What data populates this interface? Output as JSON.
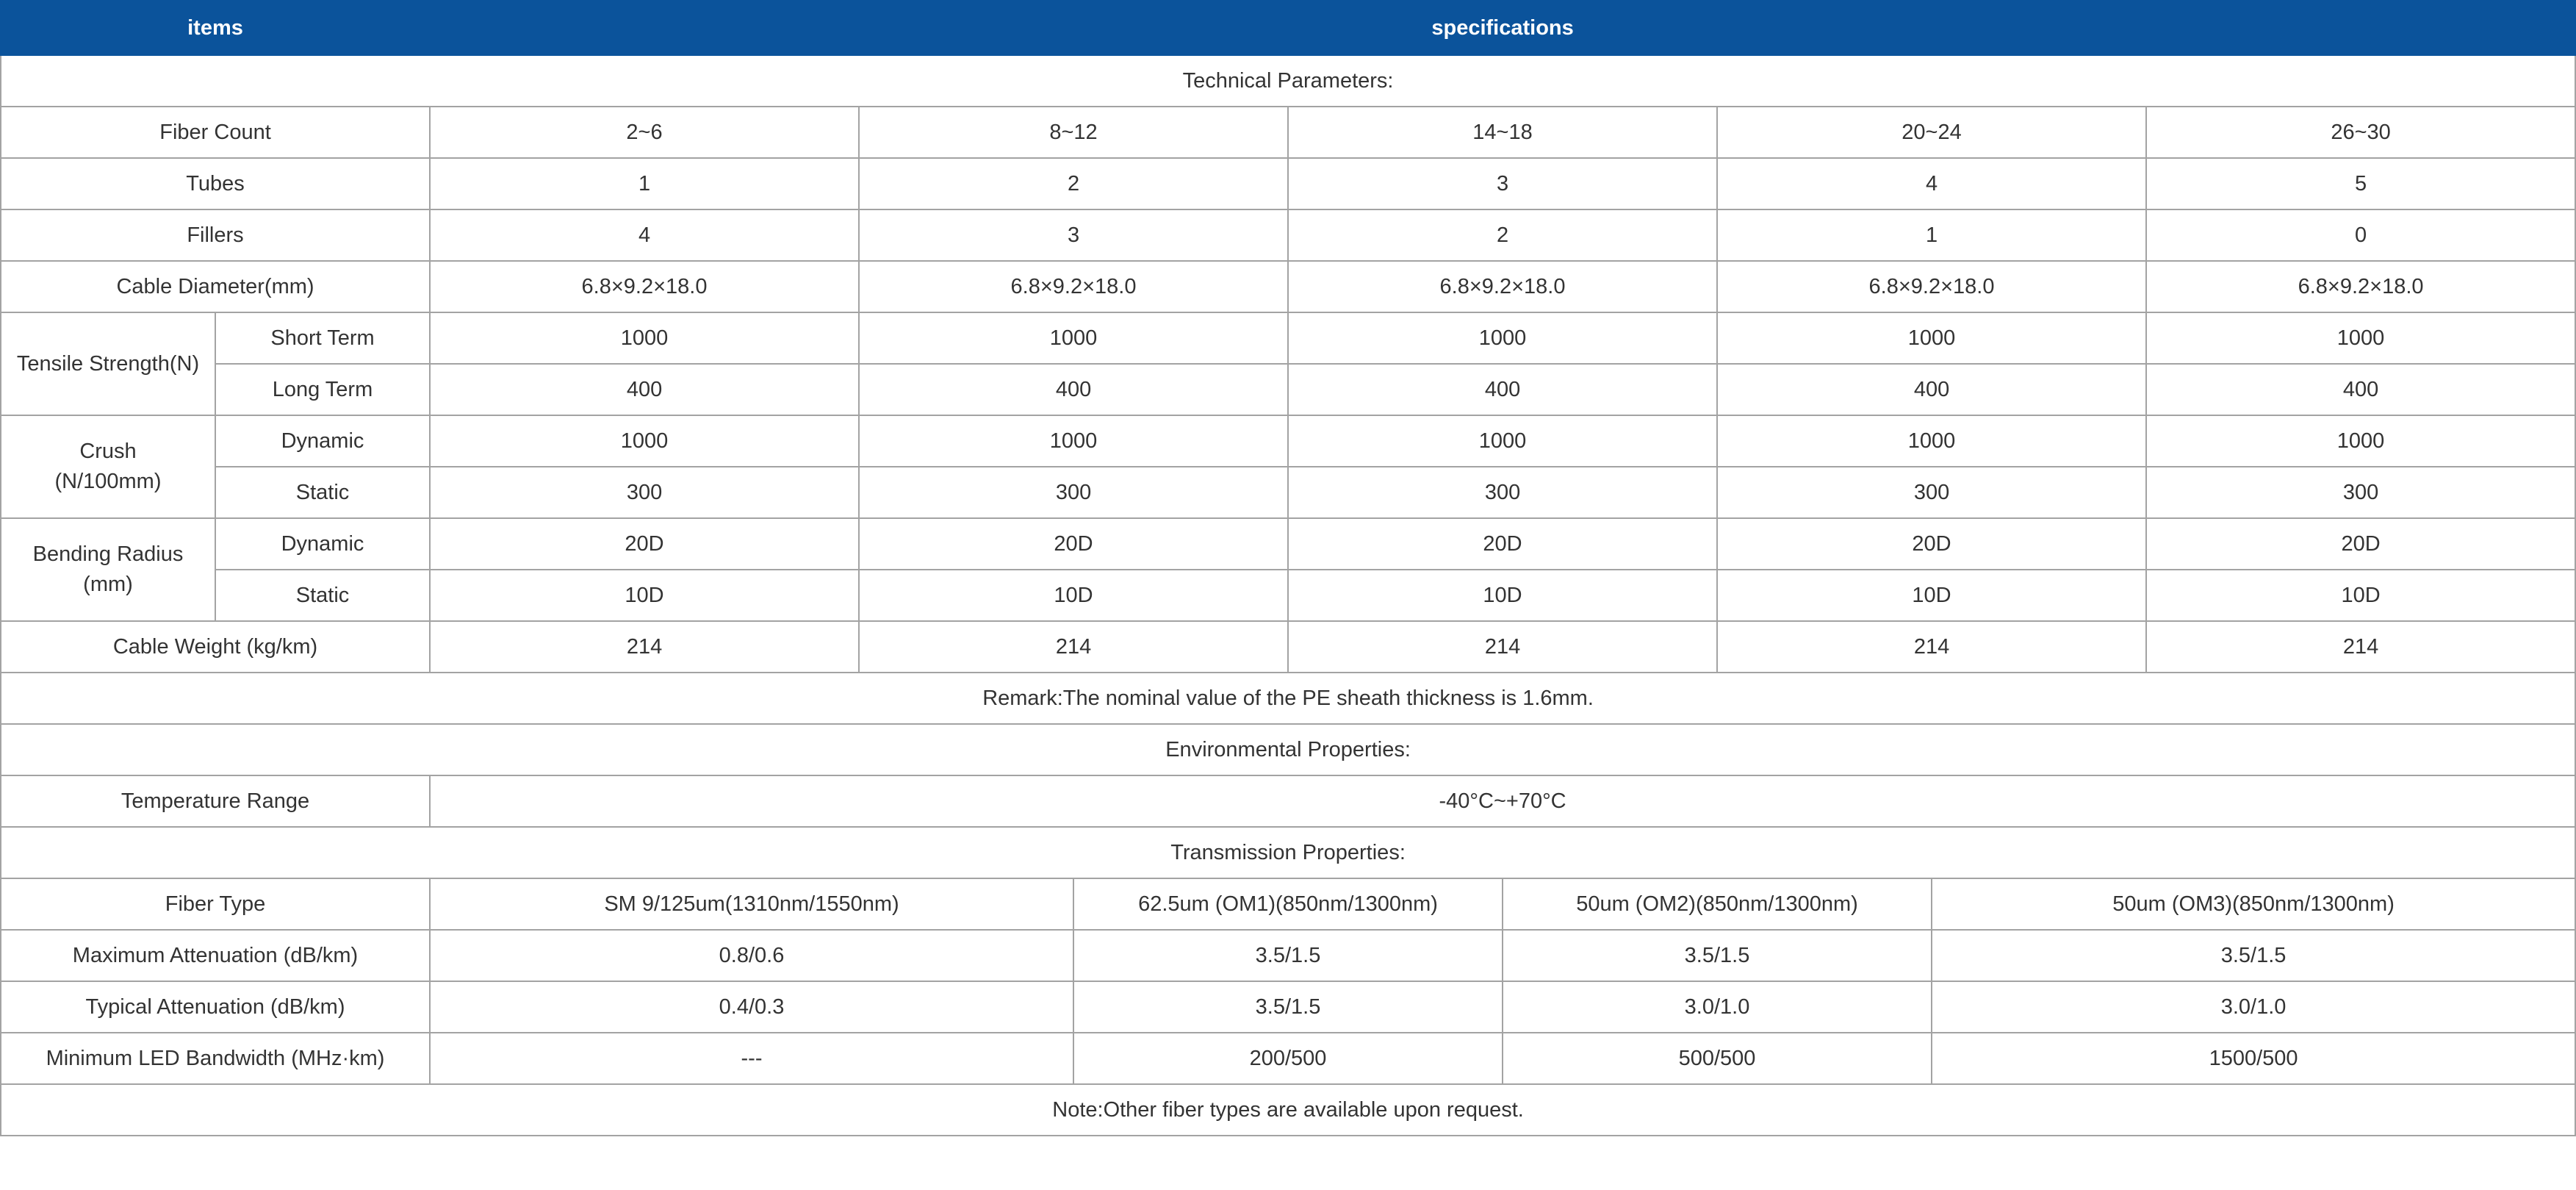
{
  "header": {
    "items": "items",
    "specifications": "specifications"
  },
  "sections": {
    "technical": "Technical Parameters:",
    "environmental": "Environmental Properties:",
    "transmission": "Transmission Properties:"
  },
  "technical": {
    "fiber_count": {
      "label": "Fiber Count",
      "values": [
        "2~6",
        "8~12",
        "14~18",
        "20~24",
        "26~30"
      ]
    },
    "tubes": {
      "label": "Tubes",
      "values": [
        "1",
        "2",
        "3",
        "4",
        "5"
      ]
    },
    "fillers": {
      "label": "Fillers",
      "values": [
        "4",
        "3",
        "2",
        "1",
        "0"
      ]
    },
    "cable_diameter": {
      "label": "Cable Diameter(mm)",
      "values": [
        "6.8×9.2×18.0",
        "6.8×9.2×18.0",
        "6.8×9.2×18.0",
        "6.8×9.2×18.0",
        "6.8×9.2×18.0"
      ]
    },
    "tensile": {
      "label": "Tensile Strength(N)",
      "short": {
        "label": "Short Term",
        "values": [
          "1000",
          "1000",
          "1000",
          "1000",
          "1000"
        ]
      },
      "long": {
        "label": "Long Term",
        "values": [
          "400",
          "400",
          "400",
          "400",
          "400"
        ]
      }
    },
    "crush": {
      "label_line1": "Crush",
      "label_line2": "(N/100mm)",
      "dynamic": {
        "label": "Dynamic",
        "values": [
          "1000",
          "1000",
          "1000",
          "1000",
          "1000"
        ]
      },
      "static": {
        "label": "Static",
        "values": [
          "300",
          "300",
          "300",
          "300",
          "300"
        ]
      }
    },
    "bending": {
      "label_line1": "Bending Radius",
      "label_line2": "(mm)",
      "dynamic": {
        "label": "Dynamic",
        "values": [
          "20D",
          "20D",
          "20D",
          "20D",
          "20D"
        ]
      },
      "static": {
        "label": "Static",
        "values": [
          "10D",
          "10D",
          "10D",
          "10D",
          "10D"
        ]
      }
    },
    "weight": {
      "label": "Cable Weight (kg/km)",
      "values": [
        "214",
        "214",
        "214",
        "214",
        "214"
      ]
    },
    "remark": "Remark:The nominal value of the PE sheath thickness is 1.6mm."
  },
  "environmental": {
    "temperature": {
      "label": "Temperature Range",
      "value": "-40°C~+70°C"
    }
  },
  "transmission": {
    "fiber_type": {
      "label": "Fiber Type",
      "values": [
        "SM 9/125um(1310nm/1550nm)",
        "62.5um (OM1)(850nm/1300nm)",
        "50um (OM2)(850nm/1300nm)",
        "50um (OM3)(850nm/1300nm)"
      ]
    },
    "max_att": {
      "label": "Maximum Attenuation (dB/km)",
      "values": [
        "0.8/0.6",
        "3.5/1.5",
        "3.5/1.5",
        "3.5/1.5"
      ]
    },
    "typ_att": {
      "label": "Typical Attenuation (dB/km)",
      "values": [
        "0.4/0.3",
        "3.5/1.5",
        "3.0/1.0",
        "3.0/1.0"
      ]
    },
    "led_bw": {
      "label": "Minimum LED Bandwidth (MHz·km)",
      "values": [
        "---",
        "200/500",
        "500/500",
        "1500/500"
      ]
    }
  },
  "note": "Note:Other fiber types are available upon request."
}
